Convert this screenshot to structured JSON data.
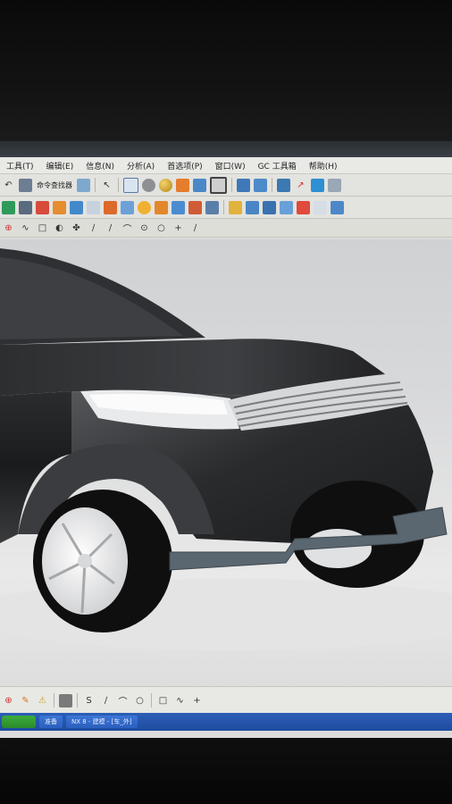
{
  "window": {
    "title": ""
  },
  "menu": {
    "items": [
      "工具(T)",
      "编辑(E)",
      "信息(N)",
      "分析(A)",
      "首选项(P)",
      "窗口(W)",
      "GC 工具箱",
      "帮助(H)"
    ]
  },
  "toolbar1": {
    "command_finder_label": "命令查找器"
  },
  "taskbar": {
    "items": [
      "准备",
      "NX 8 - 建模 - [车_外]"
    ]
  },
  "colors": {
    "car_body": "#1a1a1a",
    "bumper": "#5a6770",
    "rim": "#e8e8ea",
    "viewport_bg": "#d9d9da",
    "taskbar": "#2456ad"
  },
  "icons": [
    "undo-icon",
    "command-finder-icon",
    "snap-icon",
    "grid-icon",
    "shaded-icon",
    "sphere-icon",
    "orange-cube-icon",
    "box-view-icon",
    "color-swatch-icon",
    "feature-icon",
    "measure-icon",
    "layers-icon",
    "surface-icon",
    "sketch-icon",
    "wireframe-icon",
    "render-icon"
  ]
}
